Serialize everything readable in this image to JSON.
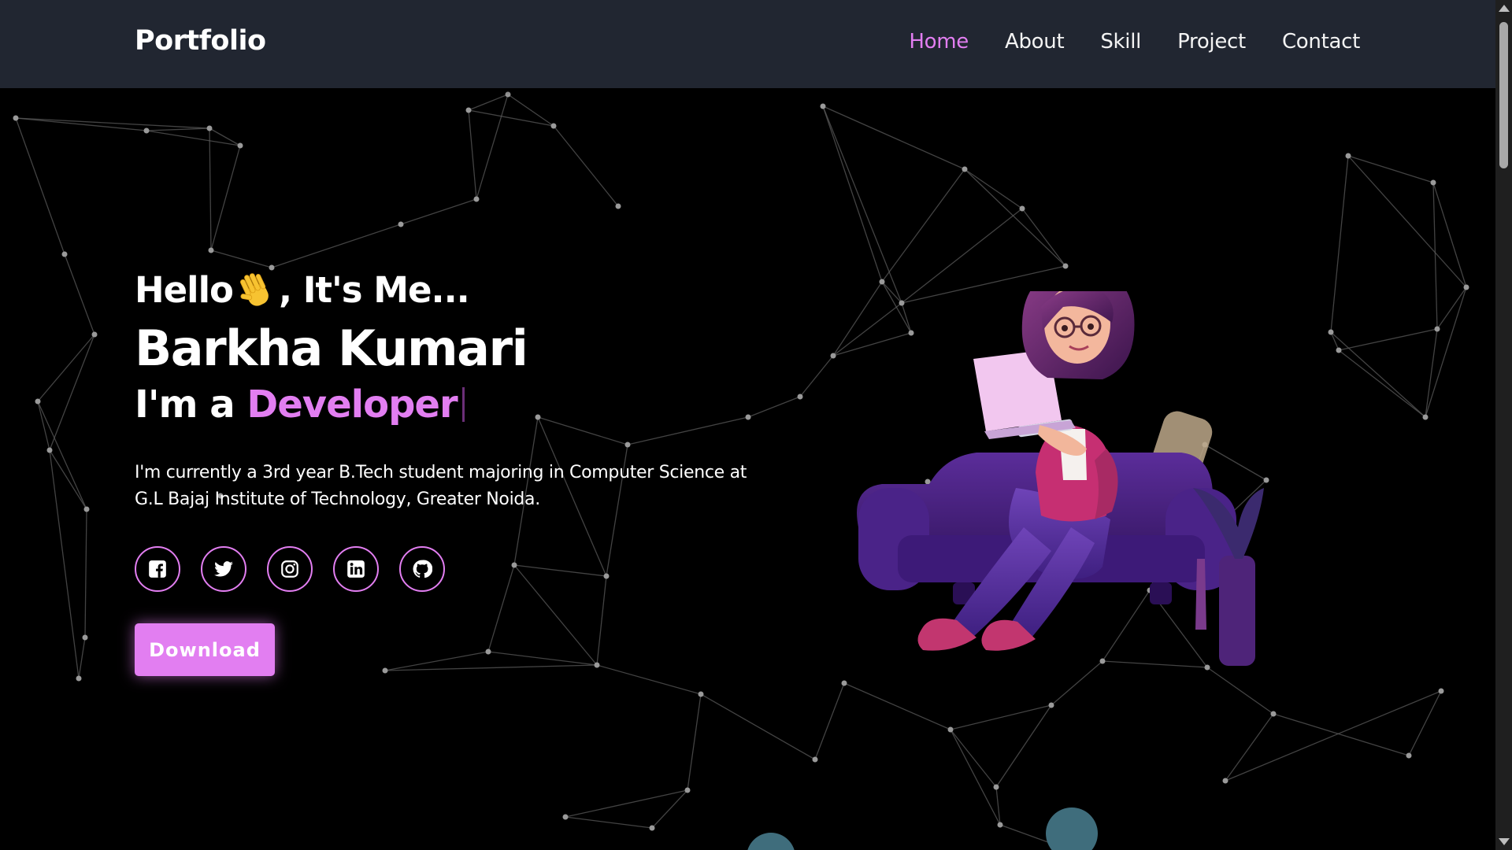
{
  "brand": "Portfolio",
  "nav": [
    {
      "label": "Home",
      "active": true
    },
    {
      "label": "About",
      "active": false
    },
    {
      "label": "Skill",
      "active": false
    },
    {
      "label": "Project",
      "active": false
    },
    {
      "label": "Contact",
      "active": false
    }
  ],
  "hero": {
    "greeting_start": "Hello",
    "greeting_end": ", It's Me...",
    "name": "Barkha Kumari",
    "role_prefix": "I'm a",
    "role": "Developer",
    "about_line1": "I'm currently a 3rd year B.Tech student majoring in Computer Science at",
    "about_line2": "G.L Bajaj Institute of Technology, Greater Noida.",
    "download_label": "Download"
  },
  "social_icons": [
    "facebook-icon",
    "twitter-icon",
    "instagram-icon",
    "linkedin-icon",
    "github-icon"
  ],
  "colors": {
    "accent": "#e27ef1",
    "navbar_bg": "#212631",
    "page_bg": "#000000",
    "network_line": "#5a5a5a"
  }
}
